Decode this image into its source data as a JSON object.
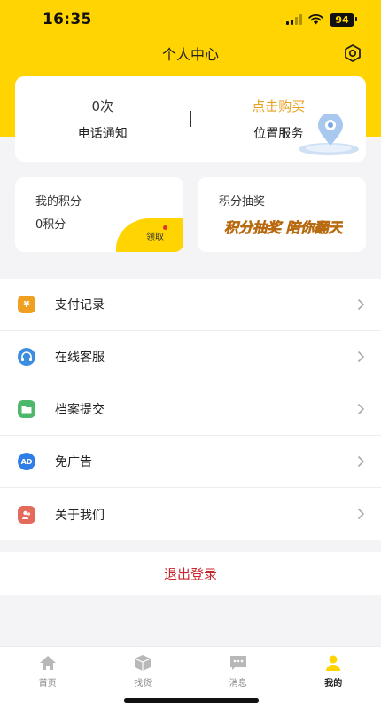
{
  "status_bar": {
    "time": "16:35",
    "battery": "94"
  },
  "nav": {
    "title": "个人中心"
  },
  "top_card": {
    "left_value": "0次",
    "left_label": "电话通知",
    "right_value": "点击购买",
    "right_label": "位置服务"
  },
  "points_card": {
    "title": "我的积分",
    "value": "0积分",
    "claim_label": "领取"
  },
  "lottery_card": {
    "title": "积分抽奖",
    "art_text": "积分抽奖 陪你翻天"
  },
  "menu": [
    {
      "label": "支付记录",
      "icon": "yen-icon",
      "color": "#f0a020"
    },
    {
      "label": "在线客服",
      "icon": "headset-icon",
      "color": "#3b8de0"
    },
    {
      "label": "档案提交",
      "icon": "folder-icon",
      "color": "#4cb86a"
    },
    {
      "label": "免广告",
      "icon": "ad-icon",
      "color": "#2f7ee8"
    },
    {
      "label": "关于我们",
      "icon": "people-icon",
      "color": "#e46a5c"
    }
  ],
  "logout_label": "退出登录",
  "tabs": [
    {
      "label": "首页",
      "icon": "home-icon",
      "active": false
    },
    {
      "label": "找货",
      "icon": "box-icon",
      "active": false
    },
    {
      "label": "消息",
      "icon": "message-icon",
      "active": false
    },
    {
      "label": "我的",
      "icon": "user-icon",
      "active": true
    }
  ],
  "colors": {
    "brand_yellow": "#ffd400",
    "accent_orange": "#e8a020",
    "logout_red": "#c8252c"
  }
}
